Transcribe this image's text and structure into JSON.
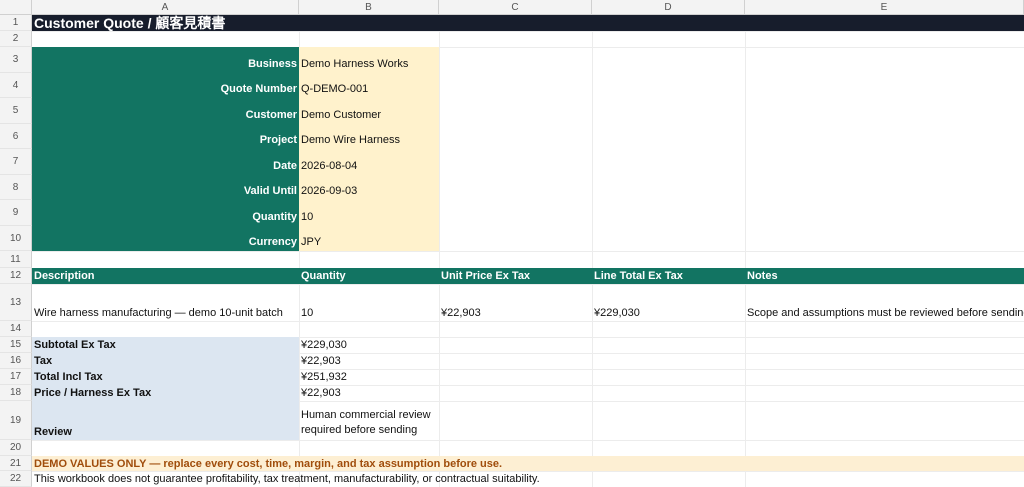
{
  "columns": [
    "A",
    "B",
    "C",
    "D",
    "E"
  ],
  "rows": [
    "1",
    "2",
    "3",
    "4",
    "5",
    "6",
    "7",
    "8",
    "9",
    "10",
    "11",
    "12",
    "13",
    "14",
    "15",
    "16",
    "17",
    "18",
    "19",
    "20",
    "21",
    "22"
  ],
  "title": "Customer Quote / 顧客見積書",
  "header_fields": [
    {
      "label": "Business",
      "value": "Demo Harness Works"
    },
    {
      "label": "Quote Number",
      "value": "Q-DEMO-001"
    },
    {
      "label": "Customer",
      "value": "Demo Customer"
    },
    {
      "label": "Project",
      "value": "Demo Wire Harness"
    },
    {
      "label": "Date",
      "value": "2026-08-04"
    },
    {
      "label": "Valid Until",
      "value": "2026-09-03"
    },
    {
      "label": "Quantity",
      "value": "10"
    },
    {
      "label": "Currency",
      "value": "JPY"
    }
  ],
  "table": {
    "headers": [
      "Description",
      "Quantity",
      "Unit Price Ex Tax",
      "Line Total Ex Tax",
      "Notes"
    ],
    "row": [
      "Wire harness manufacturing — demo 10-unit batch",
      "10",
      "¥22,903",
      "¥229,030",
      "Scope and assumptions must be reviewed before sending."
    ]
  },
  "summary": [
    {
      "label": "Subtotal Ex Tax",
      "value": "¥229,030"
    },
    {
      "label": "Tax",
      "value": "¥22,903"
    },
    {
      "label": "Total Incl Tax",
      "value": "¥251,932"
    },
    {
      "label": "Price / Harness Ex Tax",
      "value": "¥22,903"
    }
  ],
  "review": {
    "label": "Review",
    "line1": "Human commercial review",
    "line2": "required before sending"
  },
  "warning": "DEMO VALUES ONLY — replace every cost, time, margin, and tax assumption before use.",
  "disclaimer": "This workbook does not guarantee profitability, tax treatment, manufacturability, or contractual suitability.",
  "colors": {
    "title_bg": "#171d2c",
    "header_green": "#127462",
    "input_yellow": "#fff2cc",
    "summary_blue": "#dce6f1",
    "warning_bg": "#fdefd3",
    "warning_text": "#a04d0c"
  }
}
